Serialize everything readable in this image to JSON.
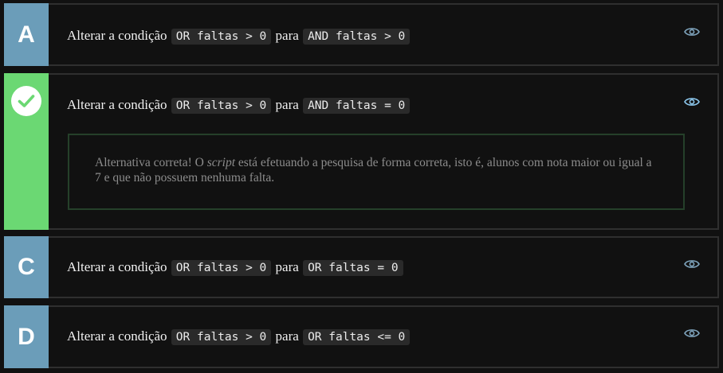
{
  "options": [
    {
      "letter": "A",
      "prefix": "Alterar a condição",
      "code_from": "OR faltas > 0",
      "middle": "para",
      "code_to": "AND faltas > 0",
      "eye_icon": "eye-icon"
    },
    {
      "letter": "",
      "status_icon": "check-icon",
      "prefix": "Alterar a condição",
      "code_from": "OR faltas > 0",
      "middle": "para",
      "code_to": "AND faltas = 0",
      "eye_icon": "eye-icon",
      "feedback": {
        "part1": "Alternativa correta! O ",
        "emphasis": "script",
        "part2": " está efetuando a pesquisa de forma correta, isto é, alunos com nota maior ou igual a 7 e que não possuem nenhuma falta."
      }
    },
    {
      "letter": "C",
      "prefix": "Alterar a condição",
      "code_from": "OR faltas > 0",
      "middle": "para",
      "code_to": "OR faltas = 0",
      "eye_icon": "eye-icon"
    },
    {
      "letter": "D",
      "prefix": "Alterar a condição",
      "code_from": "OR faltas > 0",
      "middle": "para",
      "code_to": "OR faltas <= 0",
      "eye_icon": "eye-icon"
    }
  ],
  "colors": {
    "badge": "#6b9db9",
    "badge_correct": "#6bd873",
    "feedback_border": "#25402a",
    "eye_default": "#7fa4bd",
    "eye_active": "#8dc8ee"
  }
}
